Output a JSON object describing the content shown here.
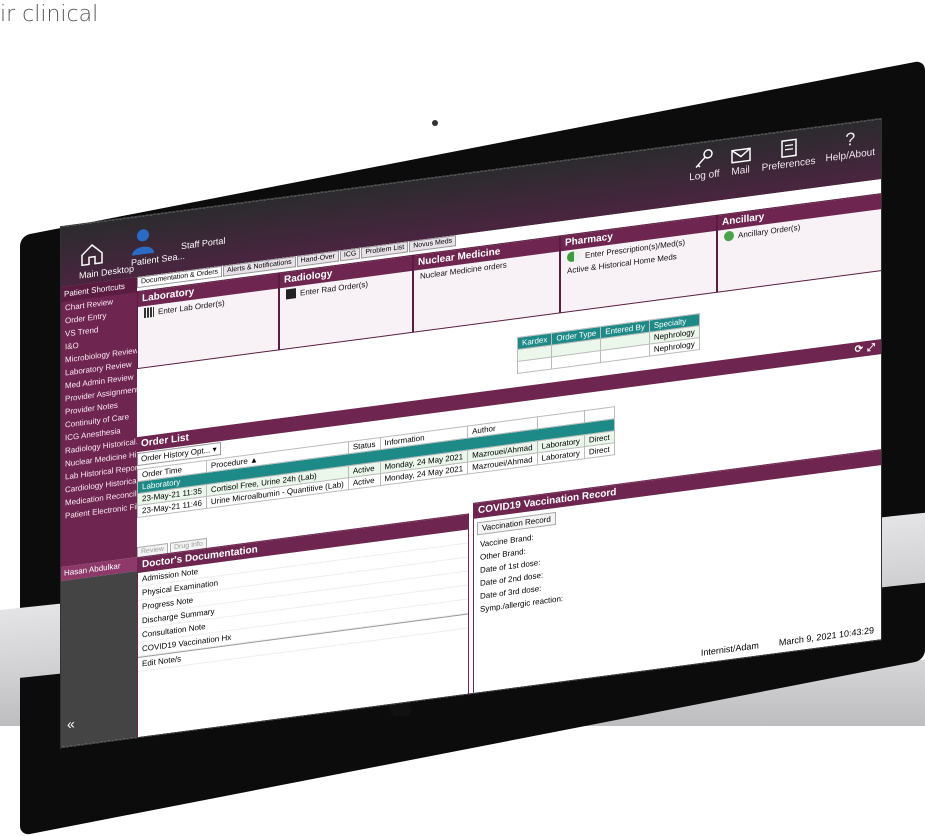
{
  "caption": "ir clinical",
  "toolbar": {
    "logoff": "Log off",
    "mail": "Mail",
    "preferences": "Preferences",
    "help": "Help/About",
    "help_glyph": "?"
  },
  "header": {
    "home_label": "Main Desktop",
    "patient_search": "Patient Sea...",
    "staff_portal": "Staff Portal"
  },
  "sidebar": {
    "title": "Patient Shortcuts",
    "items": [
      "Chart Review",
      "Order Entry",
      "VS Trend",
      "I&O",
      "Microbiology Review",
      "Laboratory Review",
      "Med Admin Review",
      "Provider Assignment",
      "Provider Notes",
      "Continuity of Care",
      "ICG Anesthesia",
      "Radiology Historical...",
      "Nuclear Medicine Hist...",
      "Lab Historical Reports",
      "Cardiology Historical...",
      "Medication Reconcili...",
      "Patient Electronic File"
    ],
    "user": "Hasan Abdulkar"
  },
  "tabs": [
    "Documentation & Orders",
    "Alerts & Notifications",
    "Hand-Over",
    "ICG",
    "Problem List",
    "Novus Meds"
  ],
  "panels": {
    "laboratory": {
      "title": "Laboratory",
      "item": "Enter Lab Order(s)"
    },
    "radiology": {
      "title": "Radiology",
      "item": "Enter Rad Order(s)"
    },
    "nuclear": {
      "title": "Nuclear Medicine",
      "item": "Nuclear Medicine orders"
    },
    "pharmacy": {
      "title": "Pharmacy",
      "item1": "Enter Prescription(s)/Med(s)",
      "item2": "Active & Historical Home Meds"
    },
    "ancillary": {
      "title": "Ancillary",
      "item": "Ancillary Order(s)"
    }
  },
  "kardex": {
    "headers": [
      "Kardex",
      "Order Type",
      "Entered By",
      "Specialty"
    ],
    "rows": [
      [
        "",
        "",
        "",
        "Nephrology"
      ],
      [
        "",
        "",
        "",
        "Nephrology"
      ]
    ]
  },
  "orders": {
    "title": "Order List",
    "history_opt": "Order History Opt...",
    "headers": [
      "Order Time",
      "Procedure ▲",
      "Status",
      "Information",
      "Author",
      "",
      ""
    ],
    "group": "Laboratory",
    "rows": [
      [
        "23-May-21 11:35",
        "Cortisol Free, Urine 24h (Lab)",
        "Active",
        "Monday, 24 May 2021",
        "Mazrouei/Ahmad",
        "Laboratory",
        "Direct"
      ],
      [
        "23-May-21 11:46",
        "Urine Microalbumin - Quantitive (Lab)",
        "Active",
        "Monday, 24 May 2021",
        "Mazrouei/Ahmad",
        "Laboratory",
        "Direct"
      ]
    ],
    "btn_review": "Review",
    "btn_druginfo": "Drug Info"
  },
  "doc": {
    "title": "Doctor's Documentation",
    "items": [
      "Admission Note",
      "Physical Examination",
      "Progress Note",
      "Discharge Summary",
      "Consultation Note",
      "COVID19 Vaccination Hx"
    ],
    "edit": "Edit Note/s"
  },
  "covid": {
    "title": "COVID19 Vaccination Record",
    "subtab": "Vaccination Record",
    "lines": [
      "Vaccine Brand:",
      "Other Brand:",
      "Date of 1st dose:",
      "Date of 2nd dose:",
      "Date of 3rd dose:",
      "Symp./allergic reaction:"
    ]
  },
  "status": {
    "user": "Internist/Adam",
    "datetime": "March 9, 2021 10:43:29"
  },
  "collapse": "«",
  "colors": {
    "plum": "#6e2650",
    "teal": "#1d8a87"
  }
}
